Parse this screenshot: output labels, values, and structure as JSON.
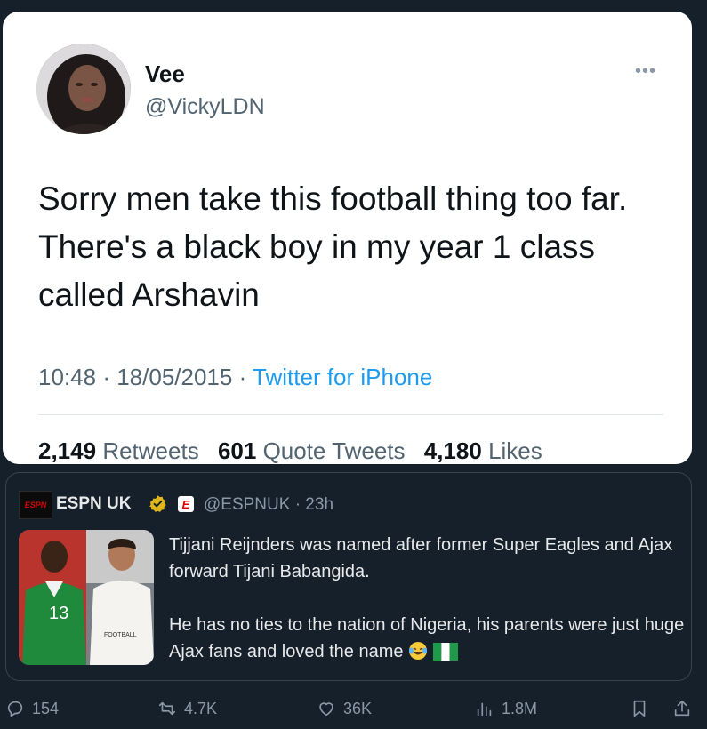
{
  "tweet": {
    "author_name": "Vee",
    "author_handle": "@VickyLDN",
    "more_icon": "more-dots-icon",
    "text": "Sorry men take this football thing too far. There's a black boy in my year 1 class called Arshavin",
    "time": "10:48",
    "date": "18/05/2015",
    "separator": "·",
    "source": "Twitter for iPhone",
    "retweets_count": "2,149",
    "retweets_label": "Retweets",
    "quotes_count": "601",
    "quotes_label": "Quote Tweets",
    "likes_count": "4,180",
    "likes_label": "Likes"
  },
  "quoted": {
    "logo_text": "ESPN",
    "name": "ESPN UK",
    "verified_icon": "gold-verified-badge-icon",
    "affiliate_text": "E",
    "handle_line": "@ESPNUK · 23h",
    "paragraph1": "Tijjani Reijnders was named after former Super Eagles and Ajax forward Tijani Babangida.",
    "paragraph2": "He has no ties to the nation of Nigeria, his parents were just huge Ajax fans and loved the name",
    "emojis": [
      "face-with-tears-of-joy",
      "nigeria-flag"
    ],
    "image_texts": [
      "13",
      "FOOTBALL"
    ]
  },
  "actions": {
    "replies": "154",
    "reposts": "4.7K",
    "likes": "36K",
    "views": "1.8M",
    "icons": [
      "reply-icon",
      "repost-icon",
      "like-icon",
      "views-icon",
      "bookmark-icon",
      "share-icon"
    ]
  },
  "colors": {
    "background": "#15202b",
    "link": "#1d9bf0",
    "muted": "#8b98a5",
    "card": "#ffffff"
  }
}
